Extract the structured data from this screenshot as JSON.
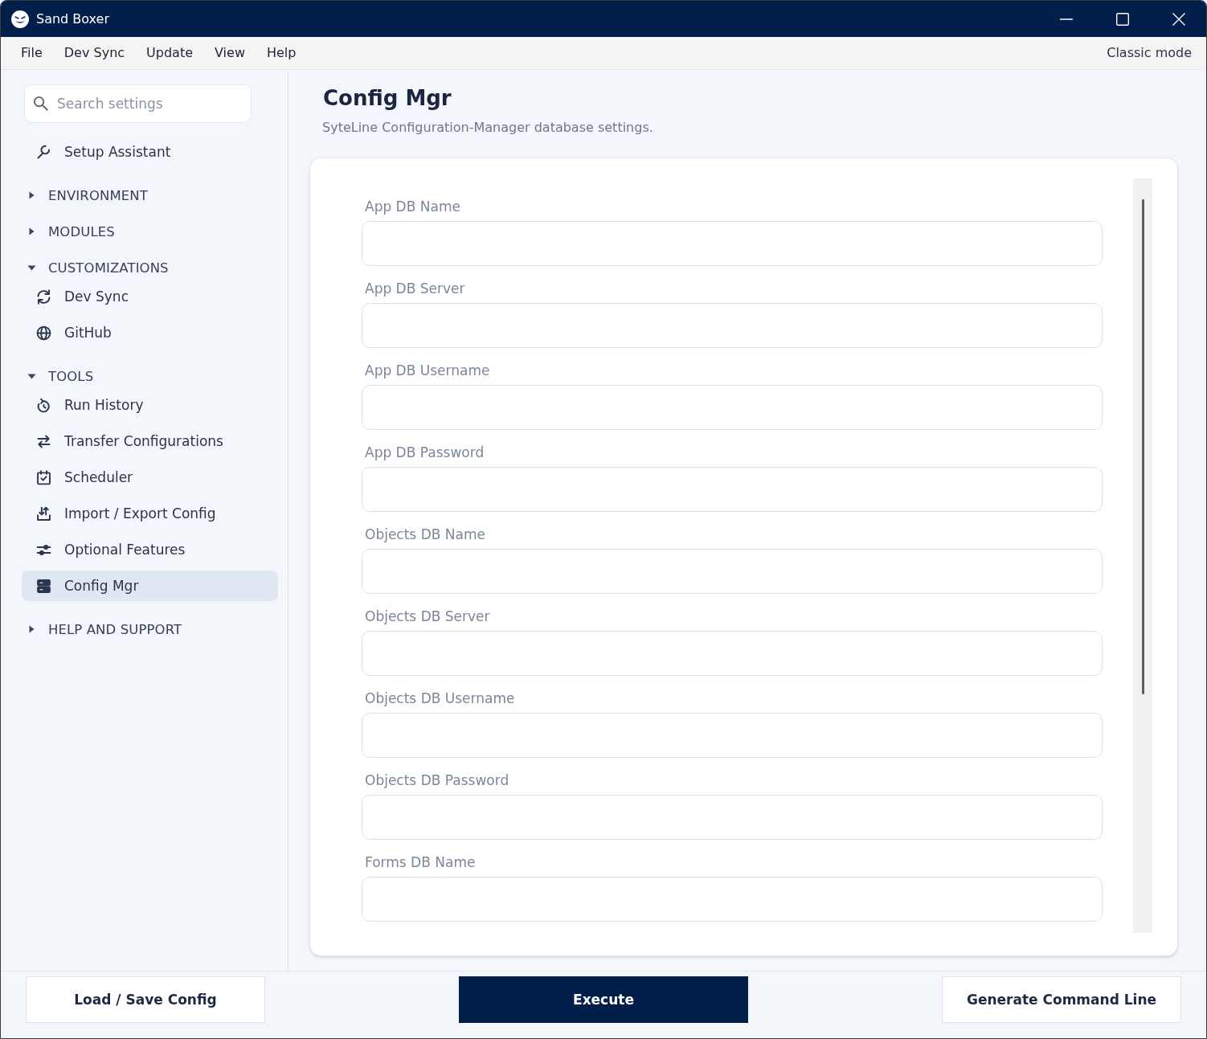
{
  "window": {
    "title": "Sand Boxer"
  },
  "menu_bar": {
    "items": [
      "File",
      "Dev Sync",
      "Update",
      "View",
      "Help"
    ],
    "mode_link": "Classic mode"
  },
  "sidebar": {
    "search": {
      "placeholder": "Search settings"
    },
    "items": [
      {
        "kind": "link",
        "label": "Setup Assistant",
        "selected": false
      },
      {
        "kind": "section",
        "label": "ENVIRONMENT",
        "expanded": false
      },
      {
        "kind": "section",
        "label": "MODULES",
        "expanded": false
      },
      {
        "kind": "section",
        "label": "CUSTOMIZATIONS",
        "expanded": true,
        "children": [
          {
            "label": "Dev Sync",
            "selected": false
          },
          {
            "label": "GitHub",
            "selected": false
          }
        ]
      },
      {
        "kind": "section",
        "label": "TOOLS",
        "expanded": true,
        "children": [
          {
            "label": "Run History",
            "selected": false
          },
          {
            "label": "Transfer Configurations",
            "selected": false
          },
          {
            "label": "Scheduler",
            "selected": false
          },
          {
            "label": "Import / Export Config",
            "selected": false
          },
          {
            "label": "Optional Features",
            "selected": false
          },
          {
            "label": "Config Mgr",
            "selected": true
          }
        ]
      },
      {
        "kind": "section",
        "label": "HELP AND SUPPORT",
        "expanded": false
      }
    ]
  },
  "main": {
    "title": "Config Mgr",
    "subtitle": "SyteLine Configuration-Manager database settings.",
    "fields": [
      {
        "label": "App DB Name"
      },
      {
        "label": "App DB Server"
      },
      {
        "label": "App DB Username"
      },
      {
        "label": "App DB Password"
      },
      {
        "label": "Objects DB Name"
      },
      {
        "label": "Objects DB Server"
      },
      {
        "label": "Objects DB Username"
      },
      {
        "label": "Objects DB Password"
      },
      {
        "label": "Forms DB Name"
      }
    ]
  },
  "footer": {
    "buttons": [
      {
        "label": "Load / Save Config",
        "kind": "secondary"
      },
      {
        "label": "Execute",
        "kind": "primary"
      },
      {
        "label": "Generate Command Line",
        "kind": "secondary"
      }
    ]
  }
}
